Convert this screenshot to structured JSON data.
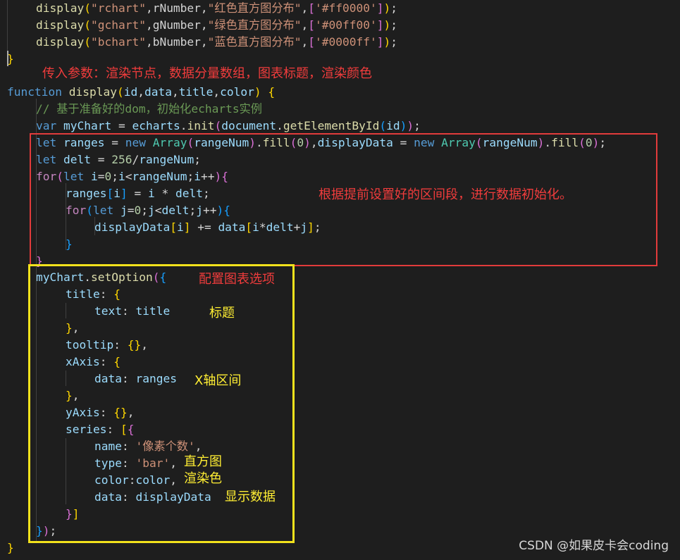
{
  "editor": {
    "lines": [
      [
        [
          "display",
          "fn"
        ],
        [
          "(",
          "br1"
        ],
        [
          "\"rchart\"",
          "str"
        ],
        [
          ",rNumber,",
          "pun"
        ],
        [
          "\"红色直方图分布\"",
          "str"
        ],
        [
          ",",
          "pun"
        ],
        [
          "[",
          "br2"
        ],
        [
          "'#ff0000'",
          "str"
        ],
        [
          "]",
          "br2"
        ],
        [
          ")",
          "br1"
        ],
        [
          ";",
          "pun"
        ]
      ],
      [
        [
          "display",
          "fn"
        ],
        [
          "(",
          "br1"
        ],
        [
          "\"gchart\"",
          "str"
        ],
        [
          ",gNumber,",
          "pun"
        ],
        [
          "\"绿色直方图分布\"",
          "str"
        ],
        [
          ",",
          "pun"
        ],
        [
          "[",
          "br2"
        ],
        [
          "'#00ff00'",
          "str"
        ],
        [
          "]",
          "br2"
        ],
        [
          ")",
          "br1"
        ],
        [
          ";",
          "pun"
        ]
      ],
      [
        [
          "display",
          "fn"
        ],
        [
          "(",
          "br1"
        ],
        [
          "\"bchart\"",
          "str"
        ],
        [
          ",bNumber,",
          "pun"
        ],
        [
          "\"蓝色直方图分布\"",
          "str"
        ],
        [
          ",",
          "pun"
        ],
        [
          "[",
          "br2"
        ],
        [
          "'#0000ff'",
          "str"
        ],
        [
          "]",
          "br2"
        ],
        [
          ")",
          "br1"
        ],
        [
          ";",
          "pun"
        ]
      ],
      [
        [
          "}",
          "br1"
        ]
      ],
      [],
      [
        [
          "function",
          "kw"
        ],
        [
          " ",
          "pun"
        ],
        [
          "display",
          "fn"
        ],
        [
          "(",
          "br1"
        ],
        [
          "id",
          "var"
        ],
        [
          ",",
          "pun"
        ],
        [
          "data",
          "var"
        ],
        [
          ",",
          "pun"
        ],
        [
          "title",
          "var"
        ],
        [
          ",",
          "pun"
        ],
        [
          "color",
          "var"
        ],
        [
          ")",
          "br1"
        ],
        [
          " ",
          "pun"
        ],
        [
          "{",
          "br1"
        ]
      ],
      [
        [
          "// 基于准备好的dom，初始化echarts实例",
          "com"
        ]
      ],
      [
        [
          "var",
          "kw"
        ],
        [
          " ",
          "pun"
        ],
        [
          "myChart",
          "var"
        ],
        [
          " = ",
          "pun"
        ],
        [
          "echarts",
          "var"
        ],
        [
          ".",
          "pun"
        ],
        [
          "init",
          "fn"
        ],
        [
          "(",
          "br2"
        ],
        [
          "document",
          "var"
        ],
        [
          ".",
          "pun"
        ],
        [
          "getElementById",
          "fn"
        ],
        [
          "(",
          "br3"
        ],
        [
          "id",
          "var"
        ],
        [
          ")",
          "br3"
        ],
        [
          ")",
          "br2"
        ],
        [
          ";",
          "pun"
        ]
      ],
      [
        [
          "let",
          "kw"
        ],
        [
          " ",
          "pun"
        ],
        [
          "ranges",
          "var"
        ],
        [
          " = ",
          "pun"
        ],
        [
          "new",
          "kw"
        ],
        [
          " ",
          "pun"
        ],
        [
          "Array",
          "cls"
        ],
        [
          "(",
          "br2"
        ],
        [
          "rangeNum",
          "var"
        ],
        [
          ")",
          "br2"
        ],
        [
          ".",
          "pun"
        ],
        [
          "fill",
          "fn"
        ],
        [
          "(",
          "br2"
        ],
        [
          "0",
          "num"
        ],
        [
          ")",
          "br2"
        ],
        [
          ",",
          "pun"
        ],
        [
          "displayData",
          "var"
        ],
        [
          " = ",
          "pun"
        ],
        [
          "new",
          "kw"
        ],
        [
          " ",
          "pun"
        ],
        [
          "Array",
          "cls"
        ],
        [
          "(",
          "br2"
        ],
        [
          "rangeNum",
          "var"
        ],
        [
          ")",
          "br2"
        ],
        [
          ".",
          "pun"
        ],
        [
          "fill",
          "fn"
        ],
        [
          "(",
          "br2"
        ],
        [
          "0",
          "num"
        ],
        [
          ")",
          "br2"
        ],
        [
          ";",
          "pun"
        ]
      ],
      [
        [
          "let",
          "kw"
        ],
        [
          " ",
          "pun"
        ],
        [
          "delt",
          "var"
        ],
        [
          " = ",
          "pun"
        ],
        [
          "256",
          "num"
        ],
        [
          "/",
          "pun"
        ],
        [
          "rangeNum",
          "var"
        ],
        [
          ";",
          "pun"
        ]
      ],
      [
        [
          "for",
          "ctl"
        ],
        [
          "(",
          "br2"
        ],
        [
          "let",
          "kw"
        ],
        [
          " ",
          "pun"
        ],
        [
          "i",
          "var"
        ],
        [
          "=",
          "pun"
        ],
        [
          "0",
          "num"
        ],
        [
          ";",
          "pun"
        ],
        [
          "i",
          "var"
        ],
        [
          "<",
          "pun"
        ],
        [
          "rangeNum",
          "var"
        ],
        [
          ";",
          "pun"
        ],
        [
          "i",
          "var"
        ],
        [
          "++",
          "pun"
        ],
        [
          ")",
          "br2"
        ],
        [
          "{",
          "br2"
        ]
      ],
      [
        [
          "ranges",
          "var"
        ],
        [
          "[",
          "br3"
        ],
        [
          "i",
          "var"
        ],
        [
          "]",
          "br3"
        ],
        [
          " = ",
          "pun"
        ],
        [
          "i",
          "var"
        ],
        [
          " * ",
          "pun"
        ],
        [
          "delt",
          "var"
        ],
        [
          ";",
          "pun"
        ]
      ],
      [
        [
          "for",
          "ctl"
        ],
        [
          "(",
          "br3"
        ],
        [
          "let",
          "kw"
        ],
        [
          " ",
          "pun"
        ],
        [
          "j",
          "var"
        ],
        [
          "=",
          "pun"
        ],
        [
          "0",
          "num"
        ],
        [
          ";",
          "pun"
        ],
        [
          "j",
          "var"
        ],
        [
          "<",
          "pun"
        ],
        [
          "delt",
          "var"
        ],
        [
          ";",
          "pun"
        ],
        [
          "j",
          "var"
        ],
        [
          "++",
          "pun"
        ],
        [
          ")",
          "br3"
        ],
        [
          "{",
          "br3"
        ]
      ],
      [
        [
          "displayData",
          "var"
        ],
        [
          "[",
          "br1"
        ],
        [
          "i",
          "var"
        ],
        [
          "]",
          "br1"
        ],
        [
          " += ",
          "pun"
        ],
        [
          "data",
          "var"
        ],
        [
          "[",
          "br1"
        ],
        [
          "i",
          "var"
        ],
        [
          "*",
          "pun"
        ],
        [
          "delt",
          "var"
        ],
        [
          "+",
          "pun"
        ],
        [
          "j",
          "var"
        ],
        [
          "]",
          "br1"
        ],
        [
          ";",
          "pun"
        ]
      ],
      [
        [
          "}",
          "br3"
        ]
      ],
      [
        [
          "}",
          "br2"
        ]
      ],
      [
        [
          "myChart",
          "var"
        ],
        [
          ".",
          "pun"
        ],
        [
          "setOption",
          "fn"
        ],
        [
          "(",
          "br2"
        ],
        [
          "{",
          "br3"
        ]
      ],
      [
        [
          "title",
          "var"
        ],
        [
          ": ",
          "pun"
        ],
        [
          "{",
          "br1"
        ]
      ],
      [
        [
          "text",
          "var"
        ],
        [
          ": ",
          "pun"
        ],
        [
          "title",
          "var"
        ]
      ],
      [
        [
          "}",
          "br1"
        ],
        [
          ",",
          "pun"
        ]
      ],
      [
        [
          "tooltip",
          "var"
        ],
        [
          ": ",
          "pun"
        ],
        [
          "{}",
          "br1"
        ],
        [
          ",",
          "pun"
        ]
      ],
      [
        [
          "xAxis",
          "var"
        ],
        [
          ": ",
          "pun"
        ],
        [
          "{",
          "br1"
        ]
      ],
      [
        [
          "data",
          "var"
        ],
        [
          ": ",
          "pun"
        ],
        [
          "ranges",
          "var"
        ]
      ],
      [
        [
          "}",
          "br1"
        ],
        [
          ",",
          "pun"
        ]
      ],
      [
        [
          "yAxis",
          "var"
        ],
        [
          ": ",
          "pun"
        ],
        [
          "{}",
          "br1"
        ],
        [
          ",",
          "pun"
        ]
      ],
      [
        [
          "series",
          "var"
        ],
        [
          ": ",
          "pun"
        ],
        [
          "[",
          "br1"
        ],
        [
          "{",
          "br2"
        ]
      ],
      [
        [
          "name",
          "var"
        ],
        [
          ": ",
          "pun"
        ],
        [
          "'像素个数'",
          "str"
        ],
        [
          ",",
          "pun"
        ]
      ],
      [
        [
          "type",
          "var"
        ],
        [
          ": ",
          "pun"
        ],
        [
          "'bar'",
          "str"
        ],
        [
          ",",
          "pun"
        ]
      ],
      [
        [
          "color",
          "var"
        ],
        [
          ":",
          "pun"
        ],
        [
          "color",
          "var"
        ],
        [
          ",",
          "pun"
        ]
      ],
      [
        [
          "data",
          "var"
        ],
        [
          ": ",
          "pun"
        ],
        [
          "displayData",
          "var"
        ]
      ],
      [
        [
          "}",
          "br2"
        ],
        [
          "]",
          "br1"
        ]
      ],
      [
        [
          "}",
          "br3"
        ],
        [
          ")",
          "br2"
        ],
        [
          ";",
          "pun"
        ]
      ],
      [
        [
          "}",
          "br1"
        ]
      ]
    ]
  },
  "annotations": {
    "params_note": "传入参数：渲染节点，数据分量数组，图表标题，渲染颜色",
    "init_note": "根据提前设置好的区间段，进行数据初始化。",
    "config_note": "配置图表选项",
    "title_note": "标题",
    "xaxis_note": "X轴区间",
    "bar_note": "直方图",
    "color_note": "渲染色",
    "data_note": "显示数据"
  },
  "watermark": "CSDN @如果皮卡会coding",
  "colors": {
    "annotation_red": "#f03c3c",
    "annotation_yellow": "#ffee33",
    "red_box": "#e23b3b",
    "yellow_box": "#f2e21c"
  }
}
